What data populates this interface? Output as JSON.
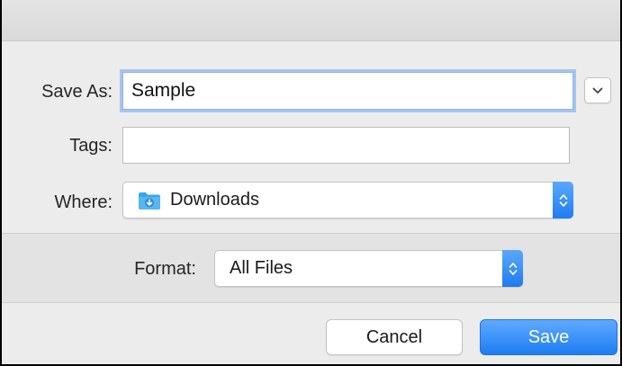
{
  "form": {
    "save_as_label": "Save As:",
    "save_as_value": "Sample",
    "tags_label": "Tags:",
    "tags_value": "",
    "where_label": "Where:",
    "where_value": "Downloads",
    "format_label": "Format:",
    "format_value": "All Files"
  },
  "buttons": {
    "cancel_label": "Cancel",
    "save_label": "Save"
  },
  "icons": {
    "expand": "chevron-down-icon",
    "folder": "downloads-folder-icon",
    "stepper": "up-down-arrows-icon"
  },
  "colors": {
    "accent": "#1d7df3",
    "focus_ring": "#a6c4f0",
    "folder_blue": "#3aa6ea"
  }
}
